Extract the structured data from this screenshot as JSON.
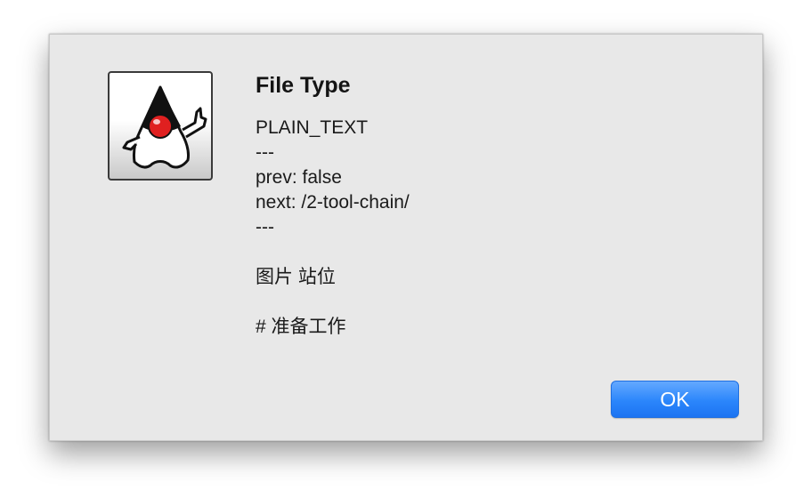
{
  "dialog": {
    "title": "File Type",
    "icon": "java-duke-icon",
    "message_lines": [
      "PLAIN_TEXT",
      "---",
      "prev: false",
      "next: /2-tool-chain/",
      "---",
      "",
      "图片 站位",
      "",
      "# 准备工作"
    ],
    "ok_label": "OK"
  },
  "colors": {
    "dialog_background": "#e8e8e8",
    "button_accent": "#2b86fb",
    "duke_nose": "#e02020"
  }
}
